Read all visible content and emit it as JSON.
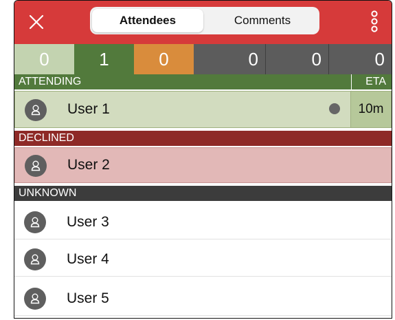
{
  "header": {
    "tabs": [
      {
        "label": "Attendees",
        "active": true
      },
      {
        "label": "Comments",
        "active": false
      }
    ],
    "close_icon": "close-icon",
    "more_icon": "more-vertical-icon",
    "accent_color": "#d63a3a"
  },
  "counts": [
    {
      "value": "0",
      "color": "#c3d3b0"
    },
    {
      "value": "1",
      "color": "#527a3c"
    },
    {
      "value": "0",
      "color": "#d98c3c"
    },
    {
      "value": "0",
      "color": "#5c5c5c"
    },
    {
      "value": "0",
      "color": "#5c5c5c"
    },
    {
      "value": "0",
      "color": "#5c5c5c"
    }
  ],
  "sections": {
    "attending": {
      "title": "ATTENDING",
      "eta_label": "ETA",
      "color": "#527a3c"
    },
    "declined": {
      "title": "DECLINED",
      "color": "#8e2a27"
    },
    "unknown": {
      "title": "UNKNOWN",
      "color": "#3c3c3c"
    }
  },
  "attending": [
    {
      "name": "User 1",
      "eta": "10m"
    }
  ],
  "declined": [
    {
      "name": "User 2"
    }
  ],
  "unknown": [
    {
      "name": "User 3"
    },
    {
      "name": "User 4"
    },
    {
      "name": "User 5"
    }
  ]
}
